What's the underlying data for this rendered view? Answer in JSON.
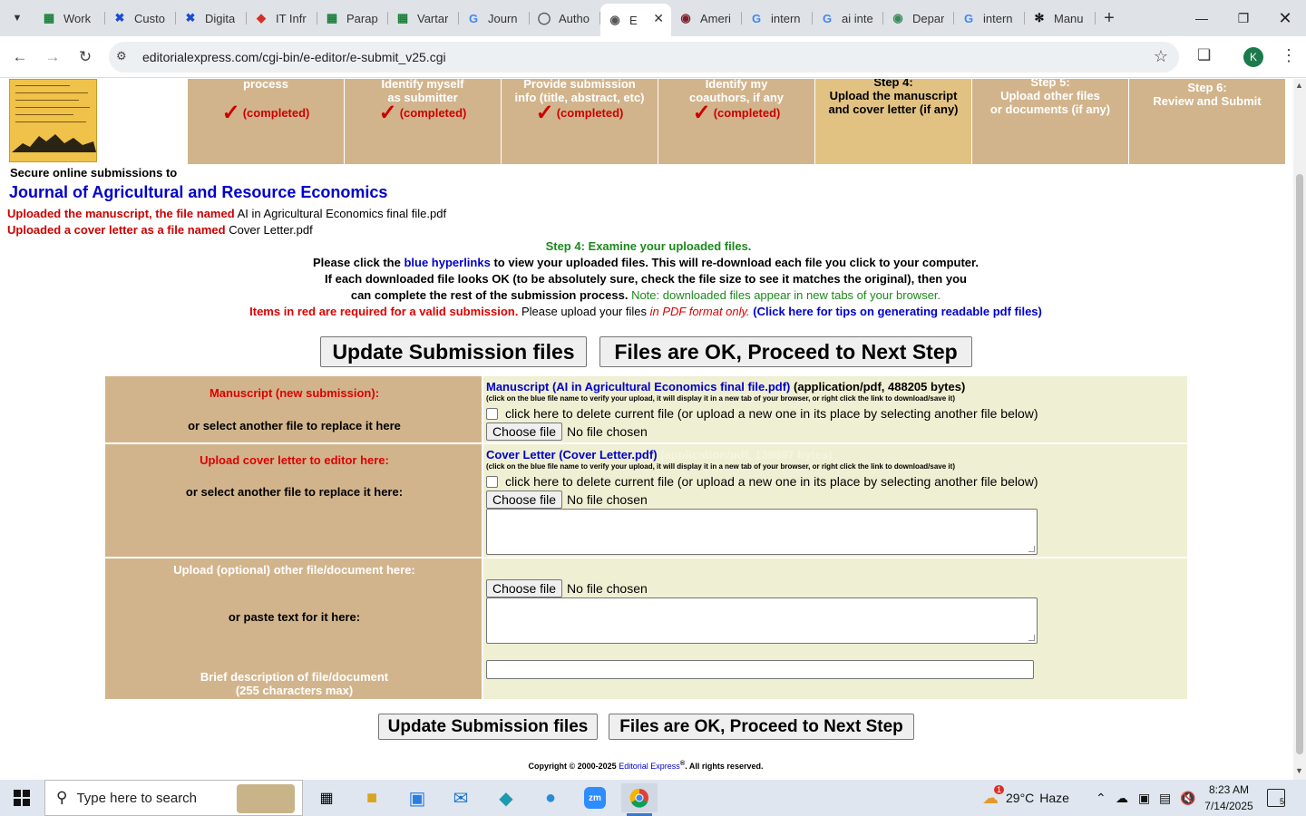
{
  "browser": {
    "tabs": [
      {
        "label": "Work",
        "icon": "sheets-icon",
        "color": "#188038"
      },
      {
        "label": "Custo",
        "icon": "x-icon",
        "color": "#1a4bd6"
      },
      {
        "label": "Digita",
        "icon": "x-icon",
        "color": "#1a4bd6"
      },
      {
        "label": "IT Infr",
        "icon": "diamond-icon",
        "color": "#d93025"
      },
      {
        "label": "Parap",
        "icon": "sheets-icon",
        "color": "#188038"
      },
      {
        "label": "Vartar",
        "icon": "sheets-icon",
        "color": "#188038"
      },
      {
        "label": "Journ",
        "icon": "google-icon",
        "color": "#4285f4"
      },
      {
        "label": "Autho",
        "icon": "circle-icon",
        "color": "#555555"
      },
      {
        "label": "E",
        "icon": "globe-icon",
        "color": "#555555",
        "active": true
      },
      {
        "label": "Ameri",
        "icon": "globe-icon",
        "color": "#7b1f2b"
      },
      {
        "label": "intern",
        "icon": "google-icon",
        "color": "#4285f4"
      },
      {
        "label": "ai inte",
        "icon": "google-icon",
        "color": "#4285f4"
      },
      {
        "label": "Depar",
        "icon": "globe-icon",
        "color": "#3c8a5a"
      },
      {
        "label": "intern",
        "icon": "google-icon",
        "color": "#4285f4"
      },
      {
        "label": "Manu",
        "icon": "chatgpt-icon",
        "color": "#111111"
      }
    ],
    "url": "editorialexpress.com/cgi-bin/e-editor/e-submit_v25.cgi",
    "avatar_letter": "K"
  },
  "page": {
    "steps": [
      {
        "title": "process",
        "status": "(completed)",
        "completed": true
      },
      {
        "title": "Identify myself\nas submitter",
        "status": "(completed)",
        "completed": true
      },
      {
        "title": "Provide submission\ninfo (title, abstract, etc)",
        "status": "(completed)",
        "completed": true
      },
      {
        "title": "Identify my\ncoauthors, if any",
        "status": "(completed)",
        "completed": true
      },
      {
        "title": "Step 4:\nUpload the manuscript\nand cover letter (if any)",
        "status": "",
        "active": true
      },
      {
        "title": "Step 5:\nUpload other files\nor documents (if any)",
        "status": ""
      },
      {
        "title": "Step 6:\nReview and Submit",
        "status": ""
      }
    ],
    "secure_label": "Secure online submissions to",
    "journal_name": "Journal of Agricultural and Resource Economics",
    "uploaded_ms_label": "Uploaded the manuscript, the file named",
    "uploaded_ms_file": "AI in Agricultural Economics final file.pdf",
    "uploaded_cl_label": "Uploaded a cover letter as a file named",
    "uploaded_cl_file": "Cover Letter.pdf",
    "step_heading": "Step 4: Examine your uploaded files.",
    "inst1_a": "Please click the",
    "inst1_link": "blue hyperlinks",
    "inst1_b": "to view your uploaded files. This will re-download each file you click to your computer.",
    "inst2": "If each downloaded file looks OK (to be absolutely sure, check the file size to see it matches the original), then you",
    "inst3_a": "can complete the rest of the submission process.",
    "inst3_note": "Note: downloaded files appear in new tabs of your browser.",
    "inst4_red": "Items in red are required for a valid submission.",
    "inst4_a": "Please upload your files",
    "inst4_pdf": "in PDF format only.",
    "inst4_link": "(Click here for tips on generating readable pdf files)",
    "btn_update": "Update Submission files",
    "btn_proceed": "Files are OK, Proceed to Next Step",
    "manuscript": {
      "label": "Manuscript (new submission):",
      "replace_label": "or select another file to replace it here",
      "file_link": "Manuscript (AI in Agricultural Economics final file.pdf)",
      "file_meta": "(application/pdf, 488205 bytes)",
      "hint": "(click on the blue file name to verify your upload, it will display it in a new tab of your browser, or right click the link to download/save it)",
      "delete_label": "click here to delete current file (or upload a new one in its place by selecting another file below)",
      "choose": "Choose file",
      "no_file": "No file chosen"
    },
    "cover": {
      "label": "Upload cover letter to editor here:",
      "replace_label": "or select another file to replace it here:",
      "file_link": "Cover Letter (Cover Letter.pdf)",
      "file_meta": "(application/pdf, 139897 bytes)",
      "hint": "(click on the blue file name to verify your upload, it will display it in a new tab of your browser, or right click the link to download/save it)",
      "delete_label": "click here to delete current file (or upload a new one in its place by selecting another file below)",
      "choose": "Choose file",
      "no_file": "No file chosen"
    },
    "other": {
      "label": "Upload (optional) other file/document here:",
      "paste_label": "or paste text for it here:",
      "desc_label_1": "Brief description of file/document",
      "desc_label_2": "(255 characters max)",
      "choose": "Choose file",
      "no_file": "No file chosen"
    },
    "copyright_a": "Copyright © 2000-2025",
    "copyright_link": "Editorial Express",
    "copyright_reg": "®",
    "copyright_b": ". All rights reserved."
  },
  "taskbar": {
    "search_placeholder": "Type here to search",
    "weather_temp": "29°C",
    "weather_text": "Haze",
    "weather_badge": "1",
    "time": "8:23 AM",
    "date": "7/14/2025",
    "notif_count": "5"
  },
  "colors": {
    "step_bg": "#d2b48c",
    "step_active_bg": "#e2c283",
    "required_red": "#dd0000",
    "link_blue": "#0000cc",
    "field_bg": "#efefd3"
  }
}
